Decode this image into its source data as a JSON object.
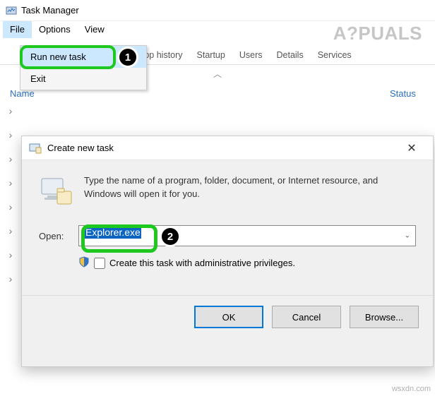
{
  "window": {
    "title": "Task Manager"
  },
  "menubar": {
    "file": "File",
    "options": "Options",
    "view": "View"
  },
  "file_menu": {
    "run_new_task": "Run new task",
    "exit": "Exit"
  },
  "tabs": {
    "app_history": "App history",
    "startup": "Startup",
    "users": "Users",
    "details": "Details",
    "services": "Services"
  },
  "columns": {
    "name": "Name",
    "status": "Status"
  },
  "dialog": {
    "title": "Create new task",
    "instruction": "Type the name of a program, folder, document, or Internet resource, and Windows will open it for you.",
    "open_label": "Open:",
    "open_value": "Explorer.exe",
    "admin_label": "Create this task with administrative privileges.",
    "buttons": {
      "ok": "OK",
      "cancel": "Cancel",
      "browse": "Browse..."
    }
  },
  "annotations": {
    "badge1": "1",
    "badge2": "2"
  },
  "watermark_main": "A?PUALS",
  "watermark_small": "wsxdn.com"
}
